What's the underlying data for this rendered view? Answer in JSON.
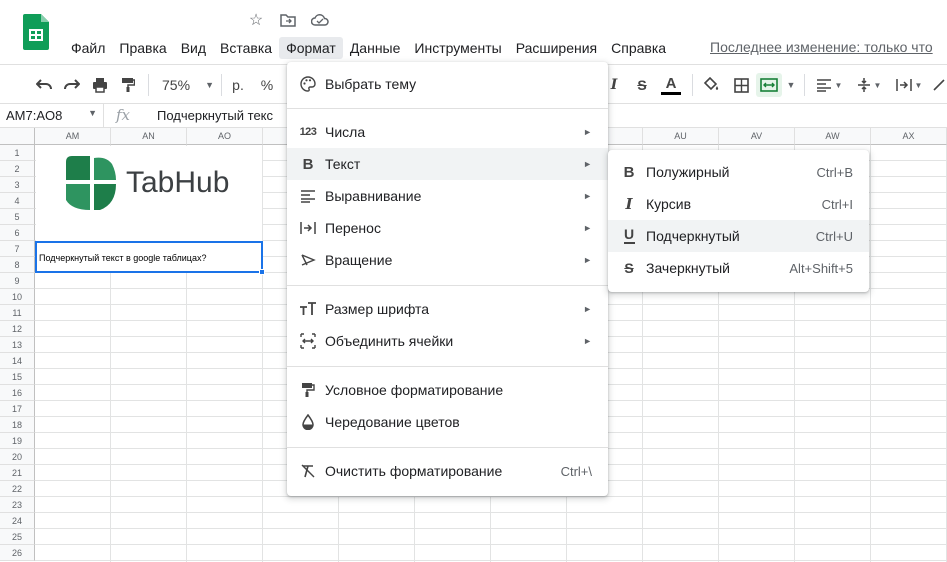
{
  "title_icons": [
    "star-icon",
    "move-to-folder-icon",
    "cloud-status-icon"
  ],
  "menubar": [
    {
      "label": "Файл"
    },
    {
      "label": "Правка"
    },
    {
      "label": "Вид"
    },
    {
      "label": "Вставка"
    },
    {
      "label": "Формат",
      "active": true
    },
    {
      "label": "Данные"
    },
    {
      "label": "Инструменты"
    },
    {
      "label": "Расширения"
    },
    {
      "label": "Справка"
    }
  ],
  "last_edit": "Последнее изменение: только что",
  "toolbar": {
    "zoom": "75%",
    "currency": "р.",
    "percent": "%"
  },
  "formula_bar": {
    "name_box": "AM7:AO8",
    "fx": "fx",
    "content": "Подчеркнутый  текс"
  },
  "columns_left": [
    "AM",
    "AN",
    "AO"
  ],
  "columns_right": [
    "AU",
    "AV",
    "AW",
    "AX"
  ],
  "rows": [
    "1",
    "2",
    "3",
    "4",
    "5",
    "6",
    "7",
    "8",
    "9",
    "10",
    "11",
    "12",
    "13",
    "14",
    "15",
    "16",
    "17",
    "18",
    "19",
    "20",
    "21",
    "22",
    "23",
    "24",
    "25",
    "26"
  ],
  "logo_text": "TabHub",
  "cell_text": "Подчеркнутый текст в google таблицах?",
  "format_menu": {
    "items": [
      {
        "label": "Выбрать тему",
        "icon": "palette-icon"
      },
      {
        "label": "Числа",
        "icon": "numbers-icon",
        "icon_text": "123",
        "submenu": true
      },
      {
        "label": "Текст",
        "icon": "bold-icon",
        "icon_text": "B",
        "submenu": true,
        "highlighted": true
      },
      {
        "label": "Выравнивание",
        "icon": "align-icon",
        "submenu": true
      },
      {
        "label": "Перенос",
        "icon": "wrap-icon",
        "submenu": true
      },
      {
        "label": "Вращение",
        "icon": "rotate-icon",
        "submenu": true
      },
      {
        "label": "Размер шрифта",
        "icon": "font-size-icon",
        "submenu": true
      },
      {
        "label": "Объединить ячейки",
        "icon": "merge-icon",
        "submenu": true
      },
      {
        "label": "Условное форматирование",
        "icon": "paint-roller-icon"
      },
      {
        "label": "Чередование цветов",
        "icon": "color-drop-icon"
      },
      {
        "label": "Очистить форматирование",
        "icon": "clear-format-icon",
        "shortcut": "Ctrl+\\"
      }
    ]
  },
  "text_submenu": {
    "items": [
      {
        "label": "Полужирный",
        "icon": "bold-icon",
        "icon_text": "B",
        "shortcut": "Ctrl+B"
      },
      {
        "label": "Курсив",
        "icon": "italic-icon",
        "icon_text": "I",
        "shortcut": "Ctrl+I"
      },
      {
        "label": "Подчеркнутый",
        "icon": "underline-icon",
        "icon_text": "U",
        "shortcut": "Ctrl+U",
        "highlighted": true
      },
      {
        "label": "Зачеркнутый",
        "icon": "strikethrough-icon",
        "icon_text": "S",
        "shortcut": "Alt+Shift+5"
      }
    ]
  },
  "colors": {
    "accent": "#1a73e8",
    "sheets_green": "#0f9d58",
    "logo_green": "#1e7e4a"
  }
}
